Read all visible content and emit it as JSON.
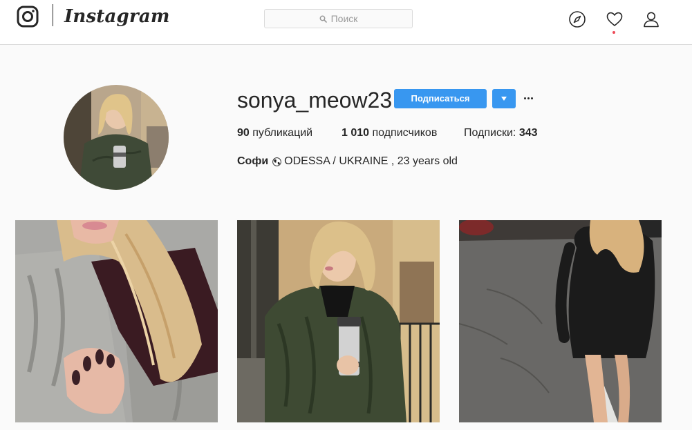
{
  "nav": {
    "wordmark": "Instagram",
    "search_placeholder": "Поиск",
    "icons": [
      "instagram-glyph-icon",
      "compass-icon",
      "heart-icon",
      "profile-icon",
      "search-icon"
    ]
  },
  "profile": {
    "username": "sonya_meow23",
    "follow_label": "Подписаться",
    "stats": {
      "posts_count": "90",
      "posts_label": "публикаций",
      "followers_count": "1 010",
      "followers_label": "подписчиков",
      "following_label": "Подписки:",
      "following_count": "343"
    },
    "bio": {
      "name": "Софи",
      "text": "ODESSA / UKRAINE , 23 years old"
    }
  },
  "colors": {
    "accent": "#3897f0",
    "notification": "#ed4956",
    "border": "#dbdbdb",
    "background": "#fafafa"
  }
}
